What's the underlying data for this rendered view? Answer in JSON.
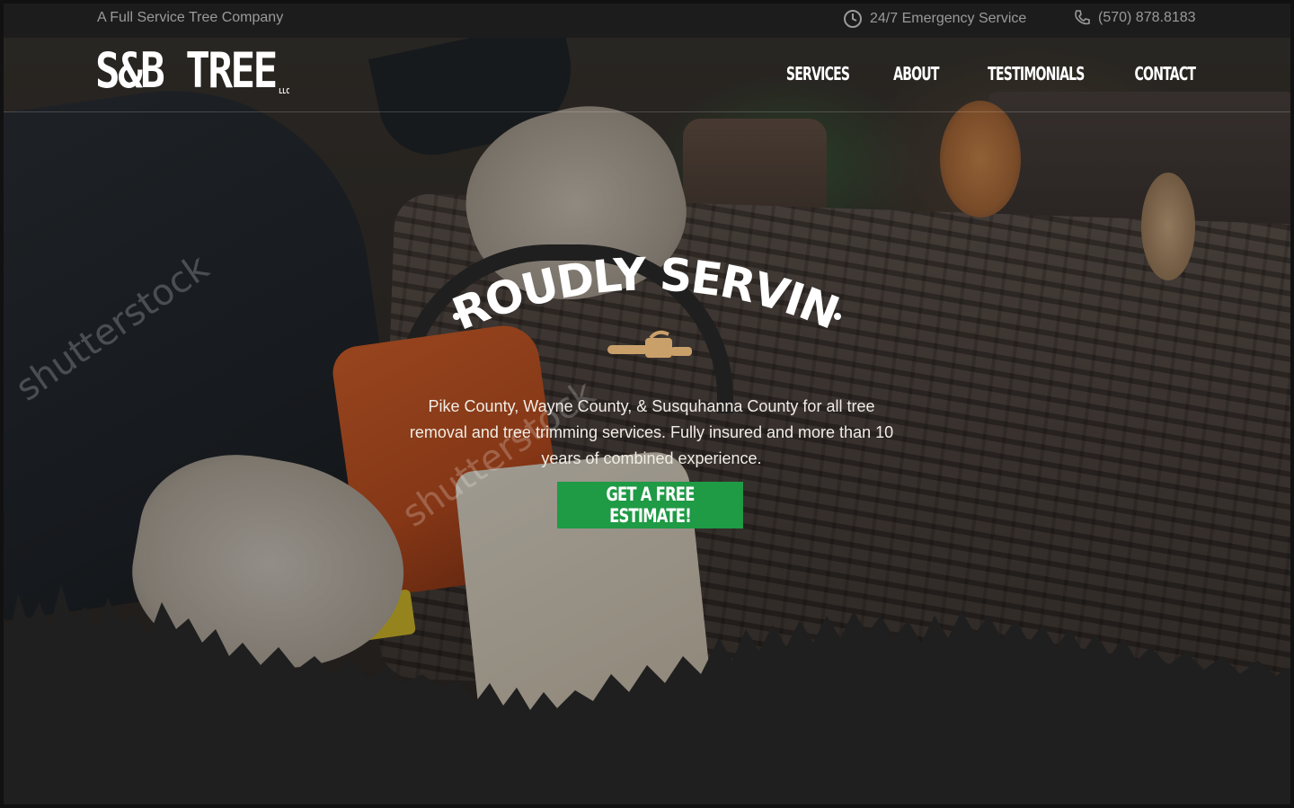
{
  "topbar": {
    "tagline": "A Full Service Tree Company",
    "emergency_text": "24/7 Emergency Service",
    "emergency_icon": "clock-icon",
    "phone_text": "(570) 878.8183",
    "phone_icon": "phone-icon"
  },
  "logo": {
    "text": "S&B TREE",
    "suffix": "LLC"
  },
  "nav": {
    "items": [
      "SERVICES",
      "ABOUT",
      "TESTIMONIALS",
      "CONTACT"
    ]
  },
  "hero": {
    "headline": "PROUDLY SERVING",
    "description": "Pike County, Wayne County,  & Susquhanna County for all tree removal and tree trimming services. Fully insured and more than 10 years of combined experience.",
    "cta_label": "GET A FREE ESTIMATE!",
    "watermark": "shutterstock"
  },
  "colors": {
    "accent_green": "#1f9a45",
    "saw_icon_tan": "#c9a06a",
    "background_dark": "#1f1f1f"
  }
}
